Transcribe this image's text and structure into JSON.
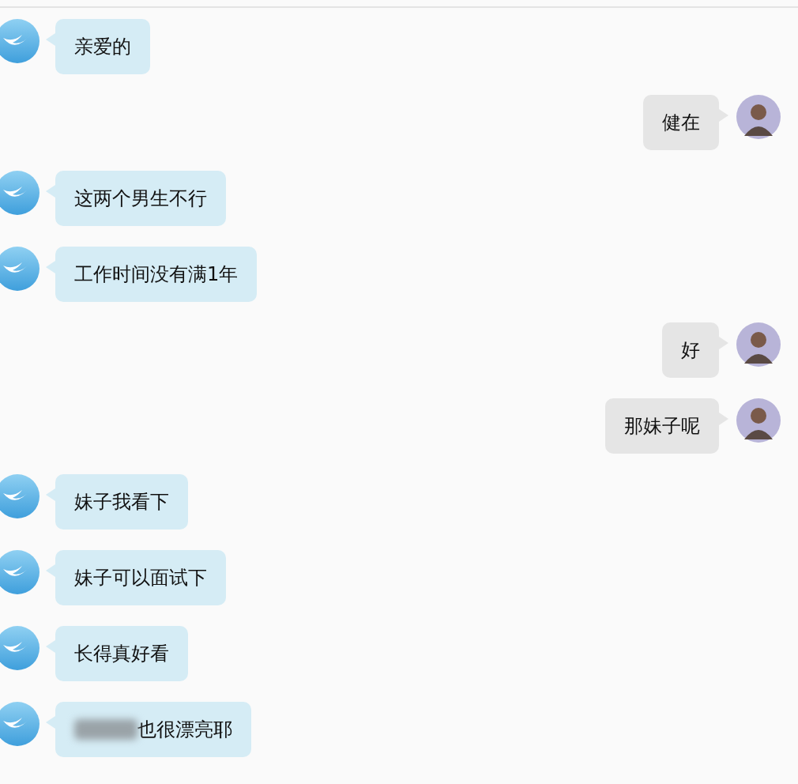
{
  "messages": [
    {
      "kind": "incoming",
      "text": "亲爱的"
    },
    {
      "kind": "outgoing",
      "text": "健在"
    },
    {
      "kind": "incoming",
      "text": "这两个男生不行"
    },
    {
      "kind": "incoming",
      "text": "工作时间没有满1年"
    },
    {
      "kind": "outgoing",
      "text": "好"
    },
    {
      "kind": "outgoing",
      "text": "那妹子呢"
    },
    {
      "kind": "incoming",
      "text": "妹子我看下"
    },
    {
      "kind": "incoming",
      "text": "妹子可以面试下"
    },
    {
      "kind": "incoming",
      "text": "长得真好看"
    },
    {
      "kind": "incoming",
      "text": "也很漂亮耶",
      "blurred_prefix": true
    }
  ]
}
